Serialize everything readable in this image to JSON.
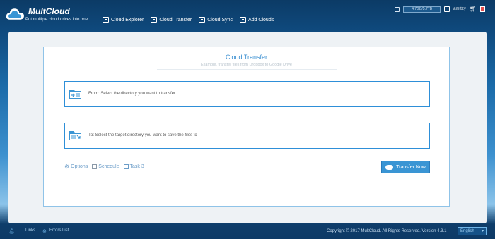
{
  "header": {
    "brand": "MultCloud",
    "tagline": "Put multiple cloud drives into one",
    "nav": [
      {
        "label": "Cloud Explorer",
        "icon": "cloud-explorer-icon"
      },
      {
        "label": "Cloud Transfer",
        "icon": "cloud-transfer-icon"
      },
      {
        "label": "Cloud Sync",
        "icon": "cloud-sync-icon"
      },
      {
        "label": "Add Clouds",
        "icon": "add-clouds-icon"
      }
    ],
    "storage": "4.7GB/5.7TB",
    "username": "amttzy"
  },
  "card": {
    "title": "Cloud Transfer",
    "subtitle": "Example, transfer files from Dropbox to Google Drive",
    "from_label": "From: Select the directory you want to transfer",
    "to_label": "To: Select the target directory you want to save the files to",
    "options_label": "Options",
    "schedule_label": "Schedule",
    "task_label": "Task 3",
    "transfer_button": "Transfer Now"
  },
  "footer": {
    "links_label": "Links",
    "errors_label": "Errors List",
    "copyright": "Copyright © 2017 MultCloud. All Rights Reserved. Version 4.3.1",
    "language": "English"
  },
  "colors": {
    "accent": "#3a95d4",
    "header_bg": "#0c3b66",
    "card_border": "#8fc3e8"
  }
}
